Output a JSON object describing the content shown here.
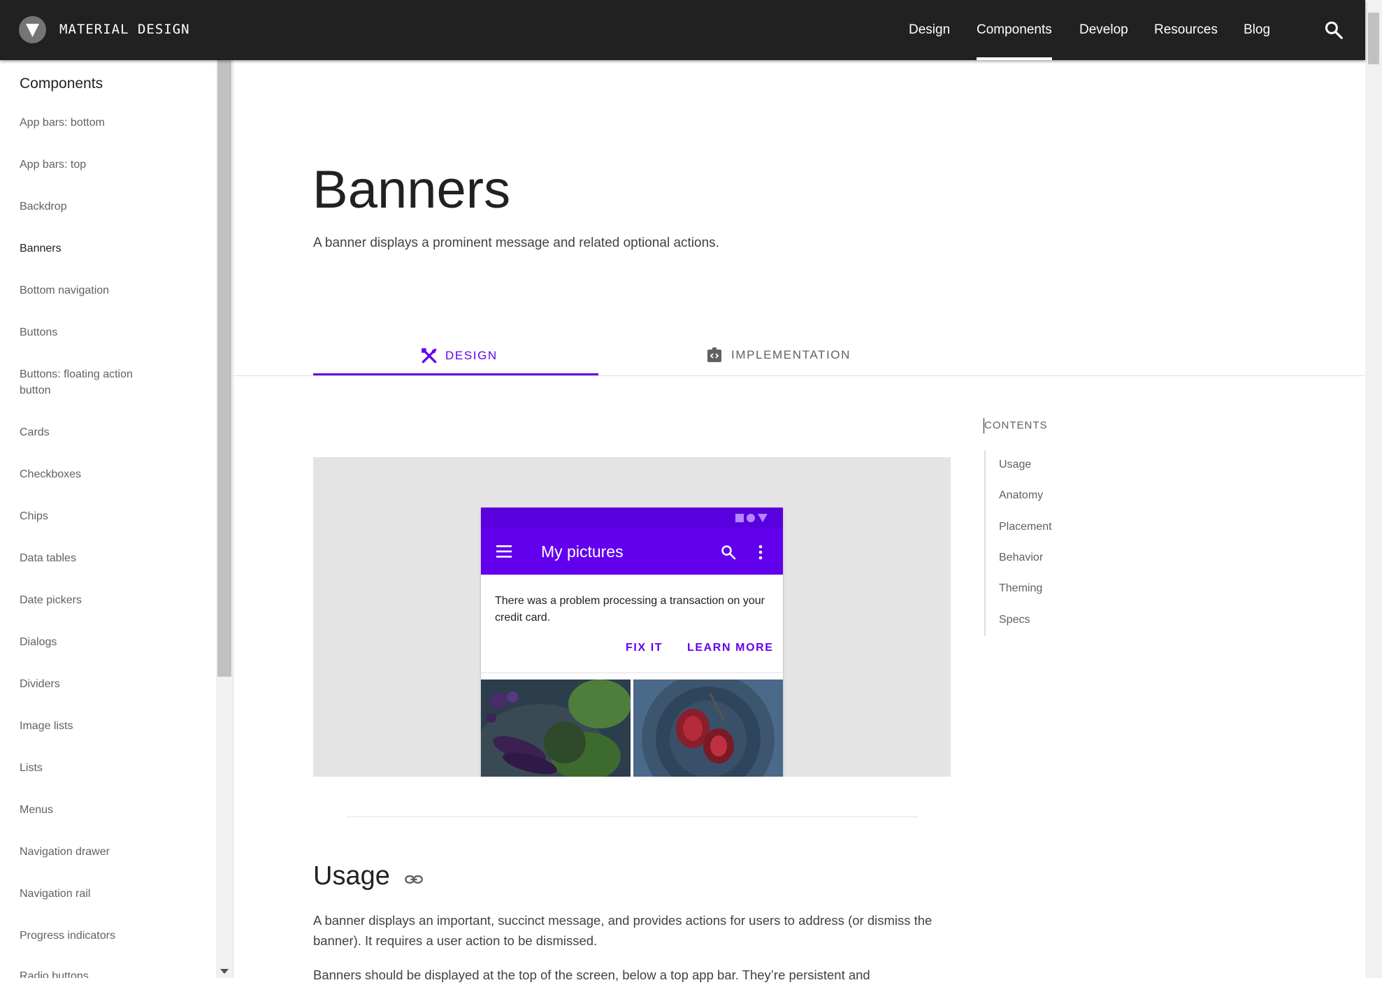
{
  "header": {
    "brand": "MATERIAL DESIGN",
    "nav": [
      "Design",
      "Components",
      "Develop",
      "Resources",
      "Blog"
    ],
    "active_nav": "Components",
    "icons": {
      "logo": "material-logo-icon",
      "search": "search-icon"
    }
  },
  "sidebar": {
    "title": "Components",
    "items": [
      "App bars: bottom",
      "App bars: top",
      "Backdrop",
      "Banners",
      "Bottom navigation",
      "Buttons",
      "Buttons: floating action button",
      "Cards",
      "Checkboxes",
      "Chips",
      "Data tables",
      "Date pickers",
      "Dialogs",
      "Dividers",
      "Image lists",
      "Lists",
      "Menus",
      "Navigation drawer",
      "Navigation rail",
      "Progress indicators",
      "Radio buttons"
    ],
    "active_item": "Banners"
  },
  "main": {
    "title": "Banners",
    "subtitle": "A banner displays a prominent message and related optional actions.",
    "tabs": [
      {
        "label": "DESIGN",
        "icon": "design-tools-icon",
        "active": true
      },
      {
        "label": "IMPLEMENTATION",
        "icon": "code-icon",
        "active": false
      }
    ],
    "hero": {
      "app_title": "My pictures",
      "banner_message": "There was a problem processing a transaction on your credit card.",
      "actions": [
        "FIX IT",
        "LEARN MORE"
      ]
    },
    "usage": {
      "heading": "Usage",
      "paragraphs": [
        "A banner displays an important, succinct message, and provides actions for users to address (or dismiss the banner). It requires a user action to be dismissed.",
        "Banners should be displayed at the top of the screen, below a top app bar. They’re persistent and"
      ]
    }
  },
  "contents": {
    "title": "CONTENTS",
    "items": [
      "Usage",
      "Anatomy",
      "Placement",
      "Behavior",
      "Theming",
      "Specs"
    ]
  },
  "colors": {
    "topbar": "#212121",
    "accent": "#6200ee",
    "hero_background": "#e4e4e4"
  }
}
